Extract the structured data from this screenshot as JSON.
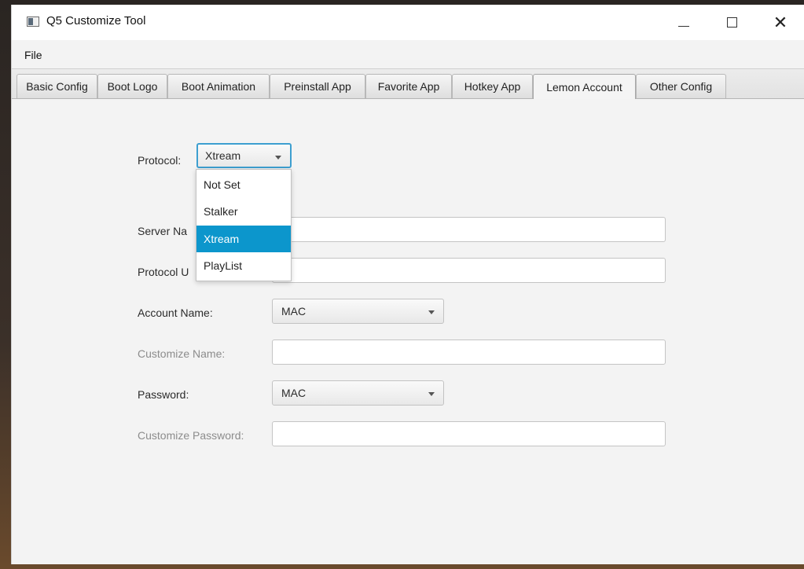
{
  "window": {
    "title": "Q5 Customize Tool"
  },
  "menu": {
    "file": "File"
  },
  "tabs": [
    {
      "label": "Basic Config"
    },
    {
      "label": "Boot Logo"
    },
    {
      "label": "Boot Animation"
    },
    {
      "label": "Preinstall App"
    },
    {
      "label": "Favorite App"
    },
    {
      "label": "Hotkey App"
    },
    {
      "label": "Lemon Account",
      "selected": true
    },
    {
      "label": "Other Config"
    }
  ],
  "form": {
    "protocol_label": "Protocol:",
    "protocol_value": "Xtream",
    "protocol_options": [
      "Not Set",
      "Stalker",
      "Xtream",
      "PlayList"
    ],
    "server_name_label": "Server Na",
    "server_name_value": "",
    "protocol_url_label": "Protocol U",
    "protocol_url_value": "",
    "account_name_label": "Account Name:",
    "account_name_value": "MAC",
    "customize_name_label": "Customize Name:",
    "customize_name_value": "",
    "password_label": "Password:",
    "password_value": "MAC",
    "customize_password_label": "Customize Password:",
    "customize_password_value": ""
  },
  "colors": {
    "accent": "#0c96cc",
    "focus_border": "#3d9fd0",
    "window_bg": "#f3f3f3"
  }
}
